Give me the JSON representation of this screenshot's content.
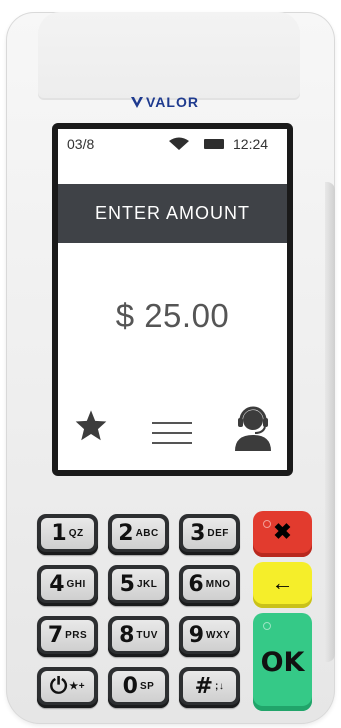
{
  "brand": {
    "logo_text": "VALOR",
    "color": "#1f3b8f"
  },
  "status": {
    "date": "03/8",
    "time": "12:24",
    "wifi_icon": "wifi-icon",
    "battery_icon": "battery-icon"
  },
  "screen": {
    "title": "ENTER AMOUNT",
    "amount": "$ 25.00",
    "toolbar": {
      "favorites_icon": "star-icon",
      "menu_icon": "menu-icon",
      "support_icon": "support-agent-icon"
    }
  },
  "keypad": {
    "keys": [
      {
        "digit": "1",
        "letters": "QZ"
      },
      {
        "digit": "2",
        "letters": "ABC"
      },
      {
        "digit": "3",
        "letters": "DEF"
      },
      {
        "digit": "4",
        "letters": "GHI"
      },
      {
        "digit": "5",
        "letters": "JKL"
      },
      {
        "digit": "6",
        "letters": "MNO"
      },
      {
        "digit": "7",
        "letters": "PRS"
      },
      {
        "digit": "8",
        "letters": "TUV"
      },
      {
        "digit": "9",
        "letters": "WXY"
      },
      {
        "digit": "⏻",
        "letters": "★+"
      },
      {
        "digit": "0",
        "letters": "SP"
      },
      {
        "digit": "#",
        "letters": ";↓"
      }
    ],
    "cancel_symbol": "✖",
    "clear_symbol": "←",
    "ok_label": "OK",
    "colors": {
      "cancel": "#e23b2e",
      "clear": "#f5ee2a",
      "ok": "#35c987"
    }
  }
}
